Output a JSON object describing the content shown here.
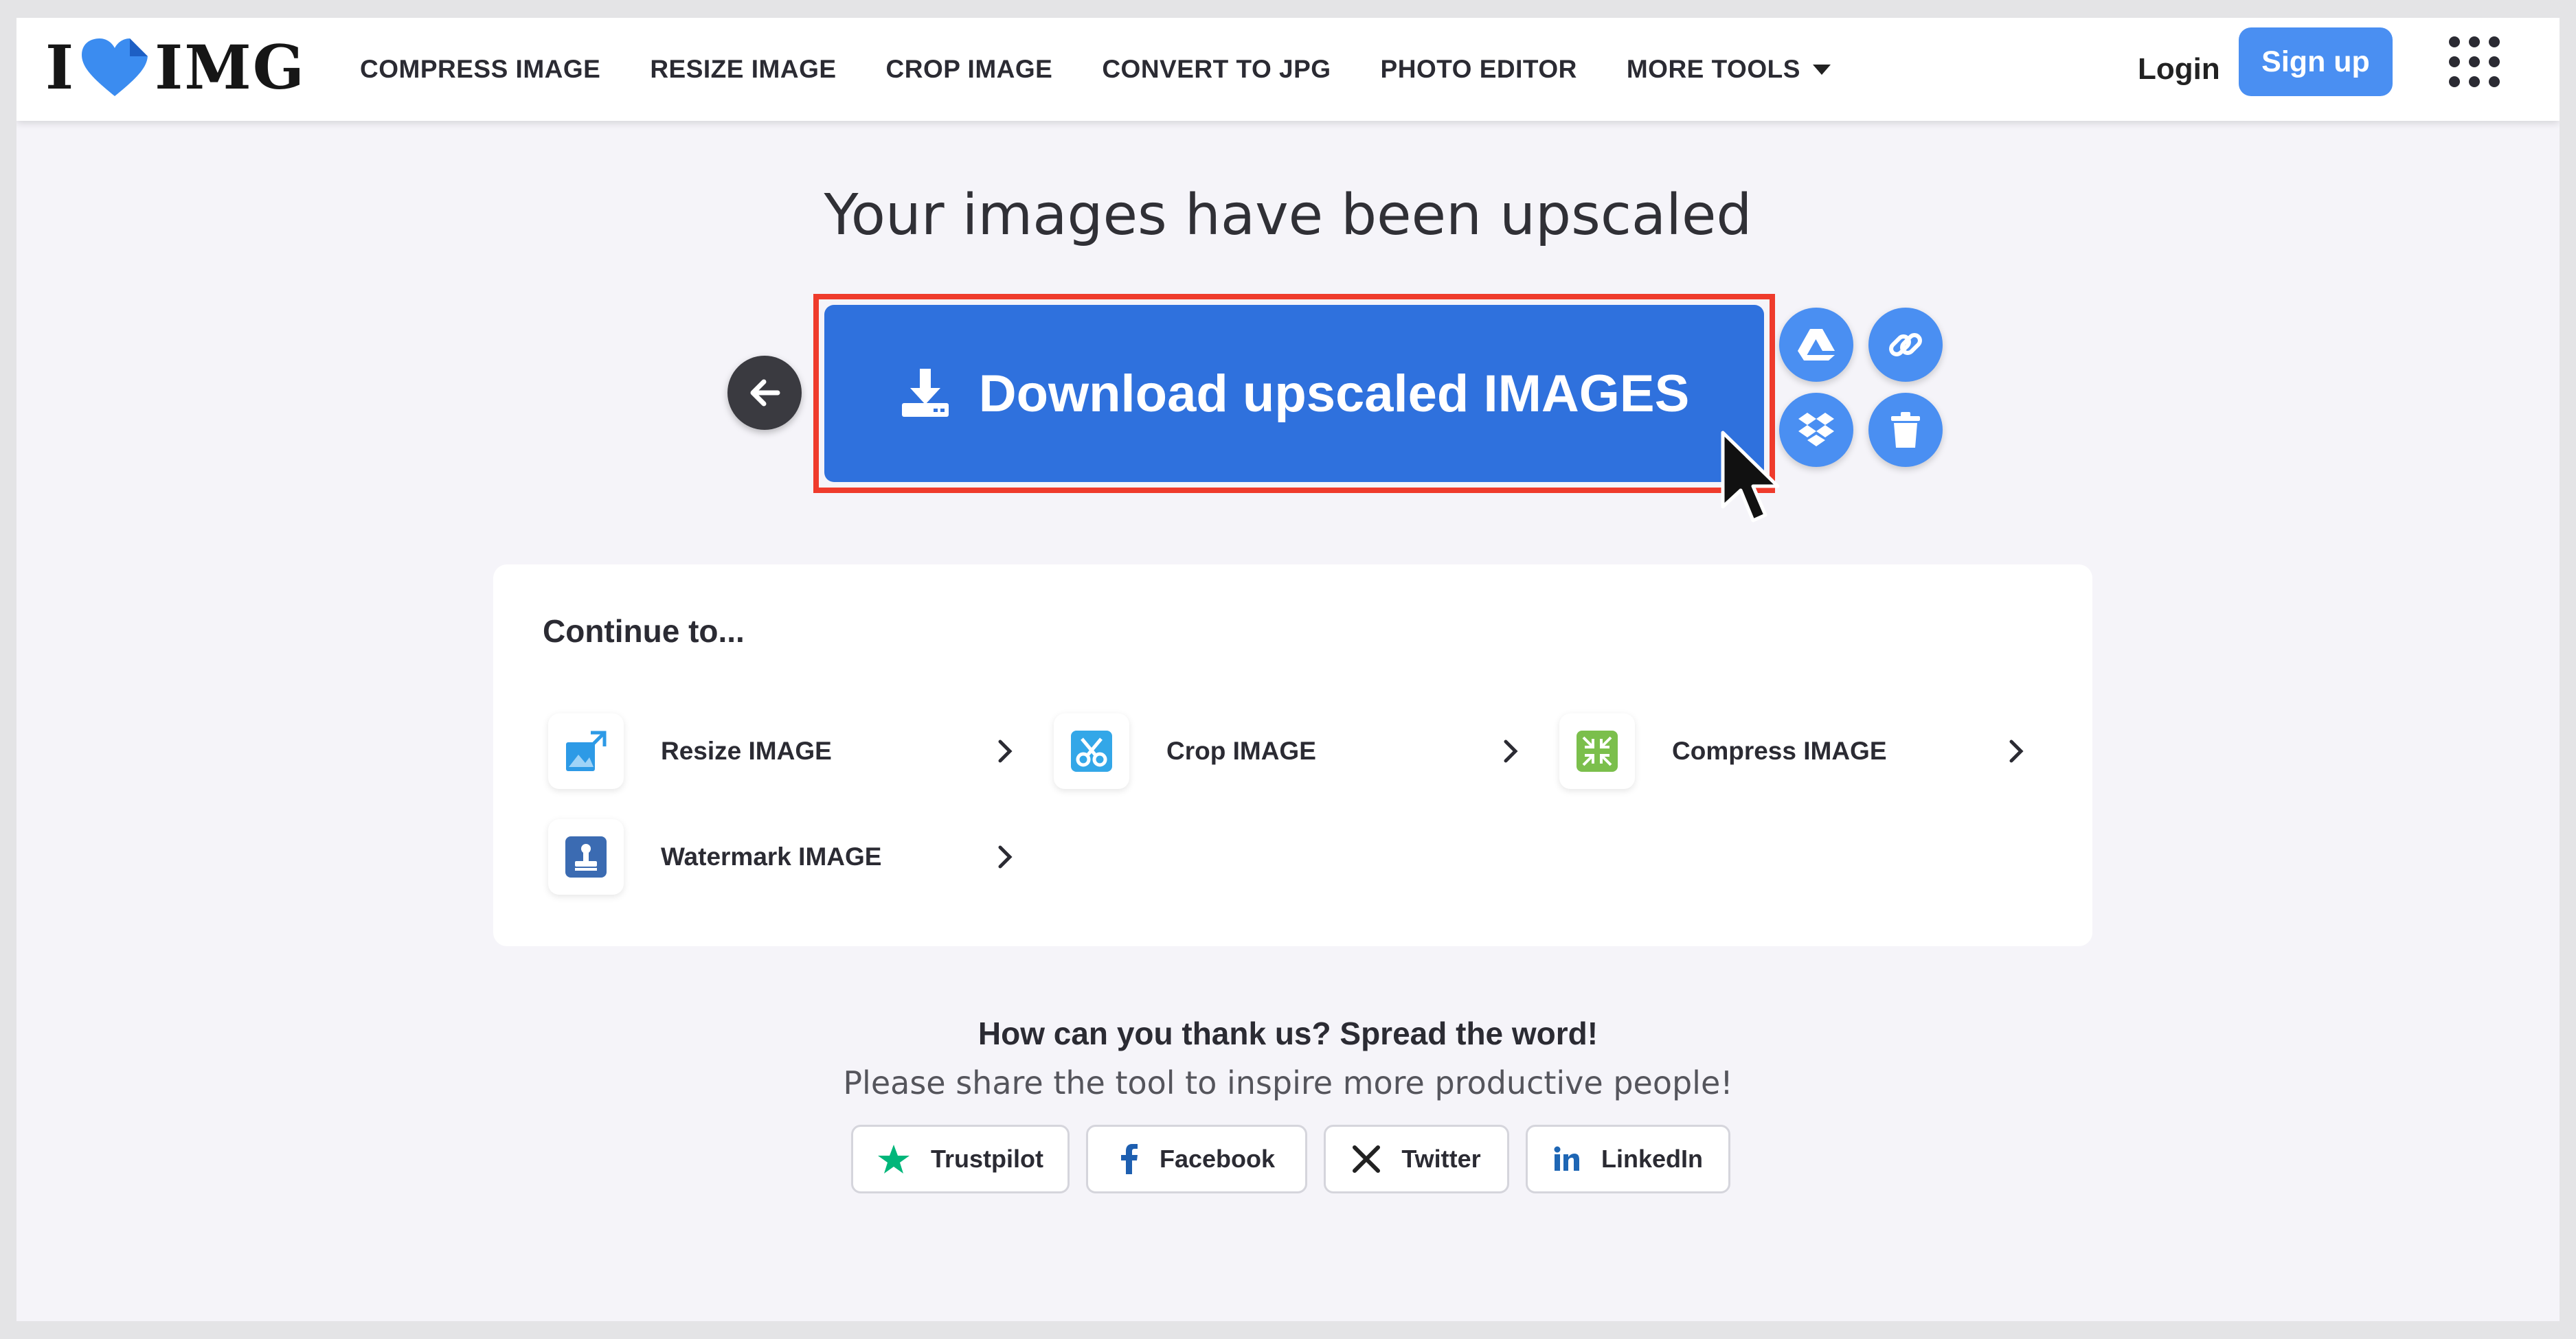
{
  "header": {
    "logo_text_left": "I",
    "logo_text_right": "IMG",
    "nav": [
      "COMPRESS IMAGE",
      "RESIZE IMAGE",
      "CROP IMAGE",
      "CONVERT TO JPG",
      "PHOTO EDITOR",
      "MORE TOOLS"
    ],
    "login_label": "Login",
    "signup_label": "Sign up"
  },
  "main": {
    "title": "Your images have been upscaled",
    "download_label": "Download upscaled IMAGES",
    "side_actions": [
      "google-drive-icon",
      "link-icon",
      "dropbox-icon",
      "trash-icon"
    ]
  },
  "continue": {
    "title": "Continue to...",
    "tools": [
      {
        "label": "Resize IMAGE",
        "icon": "resize-icon"
      },
      {
        "label": "Crop IMAGE",
        "icon": "crop-icon"
      },
      {
        "label": "Compress IMAGE",
        "icon": "compress-icon"
      },
      {
        "label": "Watermark IMAGE",
        "icon": "watermark-icon"
      }
    ]
  },
  "share": {
    "heading": "How can you thank us? Spread the word!",
    "text": "Please share the tool to inspire more productive people!",
    "buttons": [
      "Trustpilot",
      "Facebook",
      "Twitter",
      "LinkedIn"
    ]
  },
  "colors": {
    "accent": "#4a8ff2",
    "download": "#2f71dd",
    "highlight": "#ef3b2c"
  }
}
